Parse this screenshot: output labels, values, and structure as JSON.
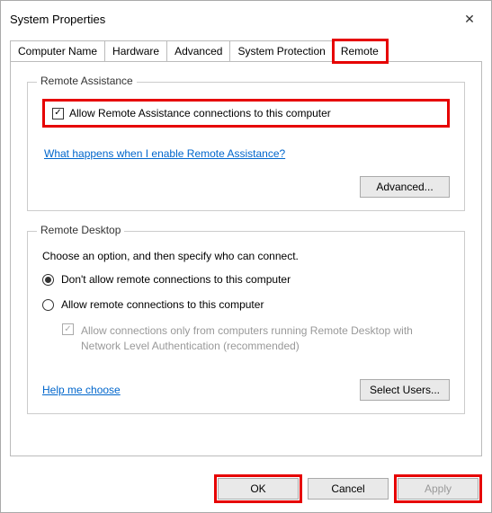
{
  "titlebar": {
    "title": "System Properties"
  },
  "tabs": {
    "computer_name": "Computer Name",
    "hardware": "Hardware",
    "advanced": "Advanced",
    "system_protection": "System Protection",
    "remote": "Remote"
  },
  "remote_assistance": {
    "group_title": "Remote Assistance",
    "allow_label": "Allow Remote Assistance connections to this computer",
    "allow_checked": true,
    "help_link": "What happens when I enable Remote Assistance?",
    "advanced_button": "Advanced..."
  },
  "remote_desktop": {
    "group_title": "Remote Desktop",
    "instruction": "Choose an option, and then specify who can connect.",
    "option_disallow": "Don't allow remote connections to this computer",
    "option_allow": "Allow remote connections to this computer",
    "selected": "disallow",
    "nla_label": "Allow connections only from computers running Remote Desktop with Network Level Authentication (recommended)",
    "nla_checked": true,
    "nla_enabled": false,
    "help_link": "Help me choose",
    "select_users_button": "Select Users..."
  },
  "footer": {
    "ok": "OK",
    "cancel": "Cancel",
    "apply": "Apply",
    "apply_enabled": false
  }
}
